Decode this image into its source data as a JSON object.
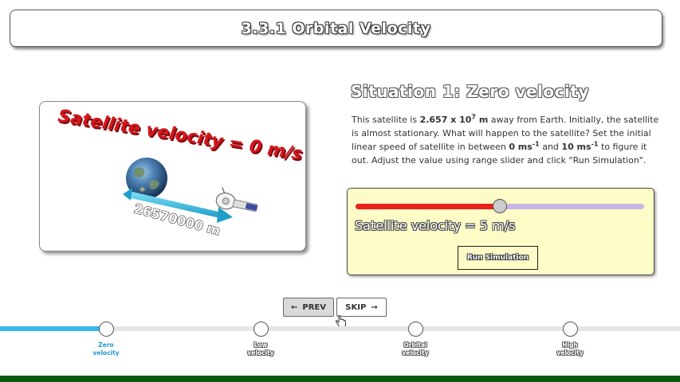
{
  "header": {
    "title": "3.3.1 Orbital Velocity"
  },
  "simulation": {
    "velocity_caption": "Satellite velocity = 0 m/s",
    "distance_label": "26570000 m",
    "colors": {
      "caption": "#d3161b",
      "arrow": "#3cc4e8"
    }
  },
  "situation": {
    "title": "Situation 1: Zero velocity",
    "desc_1": "This satellite is ",
    "distance_mantissa": "2.657 x 10",
    "distance_exp": "7",
    "distance_unit": " m",
    "desc_2": " away from Earth. Initially, the satellite is almost stationary. What will happen to the satellite? Set the initial linear speed of satellite in between ",
    "speed_min": "0 ms",
    "speed_min_exp": "-1",
    "desc_and": " and ",
    "speed_max": "10 ms",
    "speed_max_exp": "-1",
    "desc_3": " to figure it out. Adjust the value using range slider and click \"Run Simulation\"."
  },
  "controls": {
    "slider_value": 5,
    "slider_min": 0,
    "slider_max": 10,
    "velocity_label": "Satellite velocity = 5 m/s",
    "run_button": "Run Simulation",
    "colors": {
      "fill": "#e8221a",
      "track": "#c9b6e8",
      "panel": "#fdfcc6"
    }
  },
  "navigation": {
    "prev_label": "PREV",
    "skip_label": "SKIP"
  },
  "progress": {
    "fill_fraction": 0.155,
    "steps": [
      {
        "line1": "Zero",
        "line2": "velocity",
        "active": true
      },
      {
        "line1": "Low",
        "line2": "velocity",
        "active": false
      },
      {
        "line1": "Orbital",
        "line2": "velocity",
        "active": false
      },
      {
        "line1": "High",
        "line2": "velocity",
        "active": false
      }
    ],
    "colors": {
      "active": "#1e9ad6",
      "fill": "#37b7ec"
    }
  }
}
